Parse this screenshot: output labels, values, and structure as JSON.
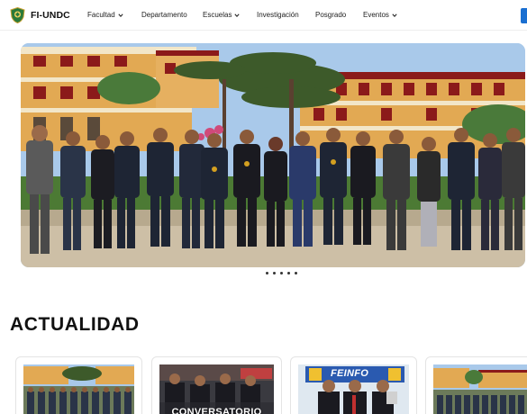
{
  "brand": {
    "name": "FI-UNDC",
    "logo_icon": "university-shield-icon"
  },
  "nav": {
    "items": [
      {
        "label": "Facultad",
        "dropdown": true
      },
      {
        "label": "Departamento",
        "dropdown": false
      },
      {
        "label": "Escuelas",
        "dropdown": true
      },
      {
        "label": "Investigación",
        "dropdown": false
      },
      {
        "label": "Posgrado",
        "dropdown": false
      },
      {
        "label": "Eventos",
        "dropdown": true
      }
    ]
  },
  "hero": {
    "slide_count": 5,
    "active_slide": 1
  },
  "news": {
    "section_title": "ACTUALIDAD",
    "cards": [
      {
        "overlay": ""
      },
      {
        "overlay": "CONVERSATORIO"
      },
      {
        "overlay": "FEINFO"
      },
      {
        "overlay": ""
      }
    ]
  },
  "colors": {
    "accent": "#1a6fd1",
    "building": "#e0a850",
    "roof": "#8b1a1a",
    "sky": "#a8c8e8"
  }
}
